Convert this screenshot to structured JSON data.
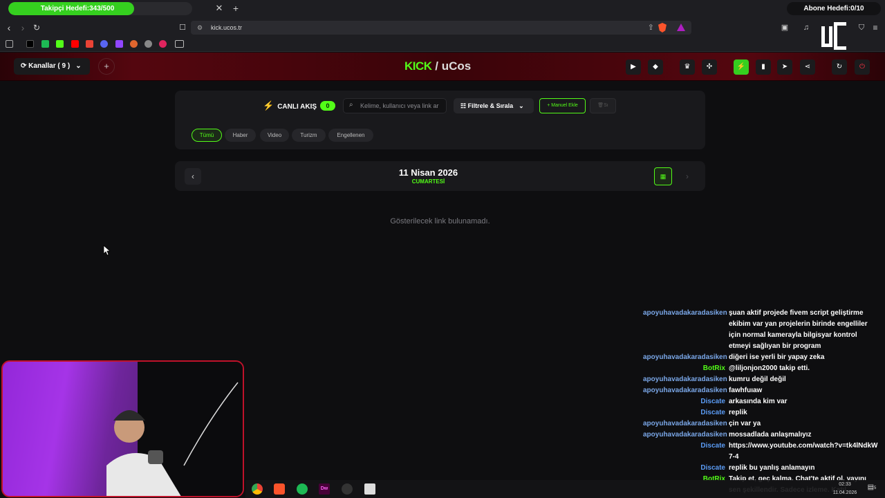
{
  "browser": {
    "follower_goal": "Takipçi Hedefi:343/500",
    "follower_progress": 0.686,
    "subscriber_goal": "Abone Hedefi:0/10",
    "url": "kick.ucos.tr"
  },
  "header": {
    "channels_label": "Kanallar ( 9 )",
    "add_label": "+",
    "brand_kick": "KICK",
    "brand_sep": "/",
    "brand_ucos": "uCos"
  },
  "filters": {
    "live_label": "CANLI AKIŞ",
    "live_count": "0",
    "search_placeholder": "Kelime, kullanıcı veya link ar",
    "filter_sort_label": "Filtrele & Sırala",
    "manual_add_label": "+ Manuel Ekle",
    "delete_label": "Sı",
    "chips": [
      "Tümü",
      "Haber",
      "Video",
      "Turizm",
      "Engellenen"
    ]
  },
  "date": {
    "date_label": "11 Nisan 2026",
    "day_label": "CUMARTESİ"
  },
  "empty_message": "Gösterilecek link bulunamadı.",
  "chat": [
    {
      "user": "apoyuhavadakaradasiken",
      "color": "#7aa7e8",
      "msg": "şuan aktif projede fivem script geliştirme ekibim var yan projelerin birinde engelliler için normal kamerayla bilgisyar kontrol etmeyi sağlıyan bir program"
    },
    {
      "user": "apoyuhavadakaradasiken",
      "color": "#7aa7e8",
      "msg": "diğeri ise yerli bir yapay zeka"
    },
    {
      "user": "BotRix",
      "color": "#53fc18",
      "msg": "@liljonjon2000 takip etti."
    },
    {
      "user": "apoyuhavadakaradasiken",
      "color": "#7aa7e8",
      "msg": "kumru değil değil"
    },
    {
      "user": "apoyuhavadakaradasiken",
      "color": "#7aa7e8",
      "msg": "fawhfuıaw"
    },
    {
      "user": "Discate",
      "color": "#5b9cf5",
      "msg": "arkasında kim var"
    },
    {
      "user": "Discate",
      "color": "#5b9cf5",
      "msg": "replik"
    },
    {
      "user": "apoyuhavadakaradasiken",
      "color": "#7aa7e8",
      "msg": "çin var ya"
    },
    {
      "user": "apoyuhavadakaradasiken",
      "color": "#7aa7e8",
      "msg": "mossadlada anlaşmalıyız"
    },
    {
      "user": "Discate",
      "color": "#5b9cf5",
      "msg": "https://www.youtube.com/watch?v=tk4lNdkW7-4"
    },
    {
      "user": "Discate",
      "color": "#5b9cf5",
      "msg": "replik bu yanlış anlamayın"
    },
    {
      "user": "BotRix",
      "color": "#53fc18",
      "msg": "Takip et, geç kalma. Chat'te aktif ol, yayını sen şekillendir. Sadece izleme. Katıl"
    }
  ],
  "taskbar": {
    "time": "02:33",
    "date": "11.04.2026",
    "notif_count": "5"
  },
  "colors": {
    "accent": "#53fc18",
    "header_bg": "#54060f",
    "webcam_border": "#c0122a"
  }
}
